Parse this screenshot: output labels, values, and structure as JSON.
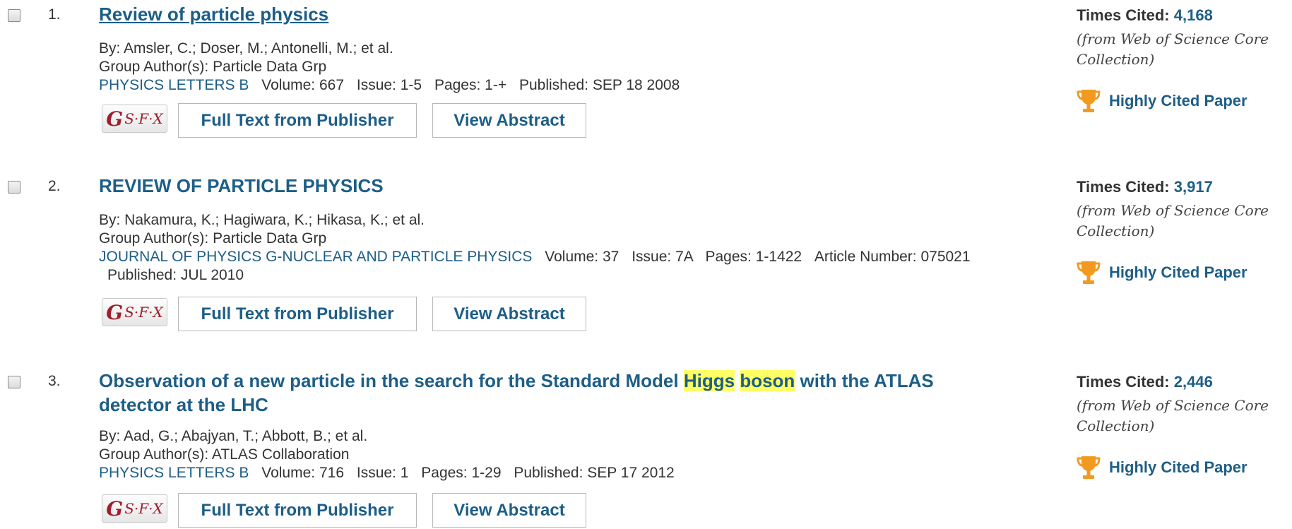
{
  "records": [
    {
      "number": "1.",
      "title": "Review of particle physics",
      "authors": "By: Amsler, C.; Doser, M.; Antonelli, M.; et al.",
      "group": "Group Author(s): Particle Data Grp",
      "journal": "PHYSICS LETTERS B",
      "volume_label": "Volume:",
      "volume": "667",
      "issue_label": "Issue:",
      "issue": "1-5",
      "pages_label": "Pages:",
      "pages": "1-+",
      "published_label": "Published:",
      "published": "SEP 18 2008",
      "times_cited_label": "Times Cited:",
      "times_cited": "4,168",
      "cited_source": "(from Web of Science Core Collection)",
      "highly_cited": "Highly Cited Paper"
    },
    {
      "number": "2.",
      "title": "REVIEW OF PARTICLE PHYSICS",
      "authors": "By: Nakamura, K.; Hagiwara, K.; Hikasa, K.; et al.",
      "group": "Group Author(s): Particle Data Grp",
      "journal": "JOURNAL OF PHYSICS G-NUCLEAR AND PARTICLE PHYSICS",
      "volume_label": "Volume:",
      "volume": "37",
      "issue_label": "Issue:",
      "issue": "7A",
      "pages_label": "Pages:",
      "pages": "1-1422",
      "article_label": "Article Number:",
      "article_number": "075021",
      "published_label": "Published:",
      "published": "JUL 2010",
      "times_cited_label": "Times Cited:",
      "times_cited": "3,917",
      "cited_source": "(from Web of Science Core Collection)",
      "highly_cited": "Highly Cited Paper"
    },
    {
      "number": "3.",
      "title_before": "Observation of a new particle in the search for the Standard Model ",
      "title_hl1": "Higgs",
      "title_hl2": "boson",
      "title_after": " with the ATLAS detector at the LHC",
      "authors": "By: Aad, G.; Abajyan, T.; Abbott, B.; et al.",
      "group": "Group Author(s): ATLAS Collaboration",
      "journal": "PHYSICS LETTERS B",
      "volume_label": "Volume:",
      "volume": "716",
      "issue_label": "Issue:",
      "issue": "1",
      "pages_label": "Pages:",
      "pages": "1-29",
      "published_label": "Published:",
      "published": "SEP 17 2012",
      "times_cited_label": "Times Cited:",
      "times_cited": "2,446",
      "cited_source": "(from Web of Science Core Collection)",
      "highly_cited": "Highly Cited Paper"
    }
  ],
  "buttons": {
    "sfx_label": "S·F·X",
    "sfx_glyph": "G",
    "full_text": "Full Text from Publisher",
    "view_abstract": "View Abstract"
  },
  "icons": {
    "checkbox": "checkbox-icon",
    "trophy": "trophy-icon",
    "sfx": "sfx-logo-icon"
  },
  "colors": {
    "link": "#1d5e87",
    "highlight": "#ffff66",
    "trophy": "#f29a1f",
    "sfx_red": "#a01e2d"
  }
}
